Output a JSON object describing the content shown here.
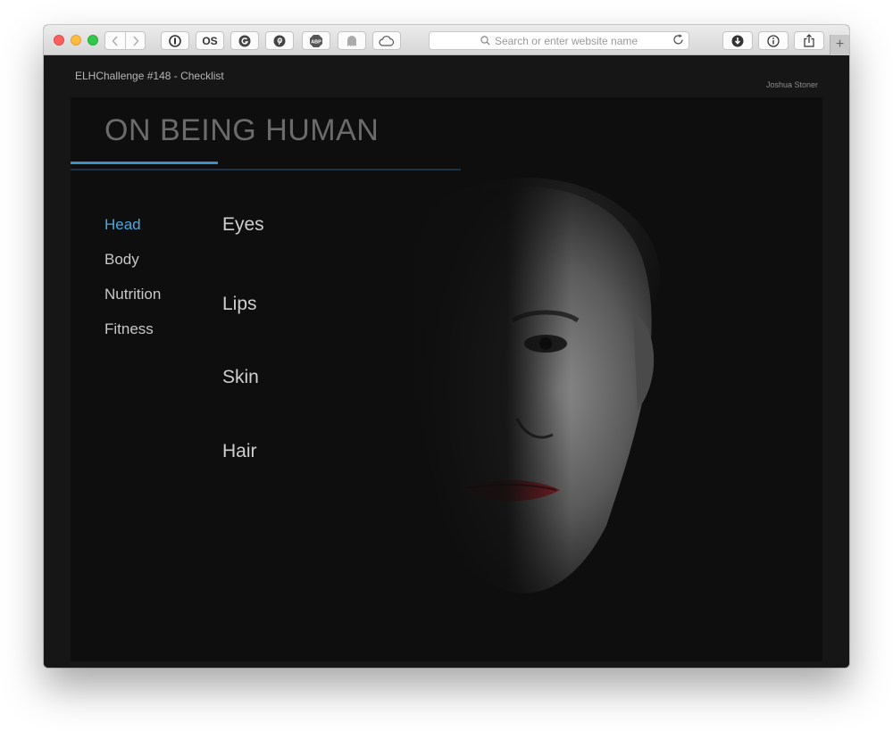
{
  "browser": {
    "address_placeholder": "Search or enter website name",
    "new_tab_label": "+",
    "extension_os_label": "OS",
    "extension_abp_label": "ABP"
  },
  "page": {
    "tab_title": "ELHChallenge #148 - Checklist",
    "author": "Joshua Stoner",
    "hero_title": "ON BEING HUMAN"
  },
  "nav": {
    "items": [
      {
        "label": "Head",
        "active": true
      },
      {
        "label": "Body",
        "active": false
      },
      {
        "label": "Nutrition",
        "active": false
      },
      {
        "label": "Fitness",
        "active": false
      }
    ]
  },
  "topics": {
    "items": [
      {
        "label": "Eyes"
      },
      {
        "label": "Lips"
      },
      {
        "label": "Skin"
      },
      {
        "label": "Hair"
      }
    ]
  },
  "colors": {
    "accent": "#49a8e0",
    "background": "#161616",
    "stage": "#0e0e0e"
  }
}
